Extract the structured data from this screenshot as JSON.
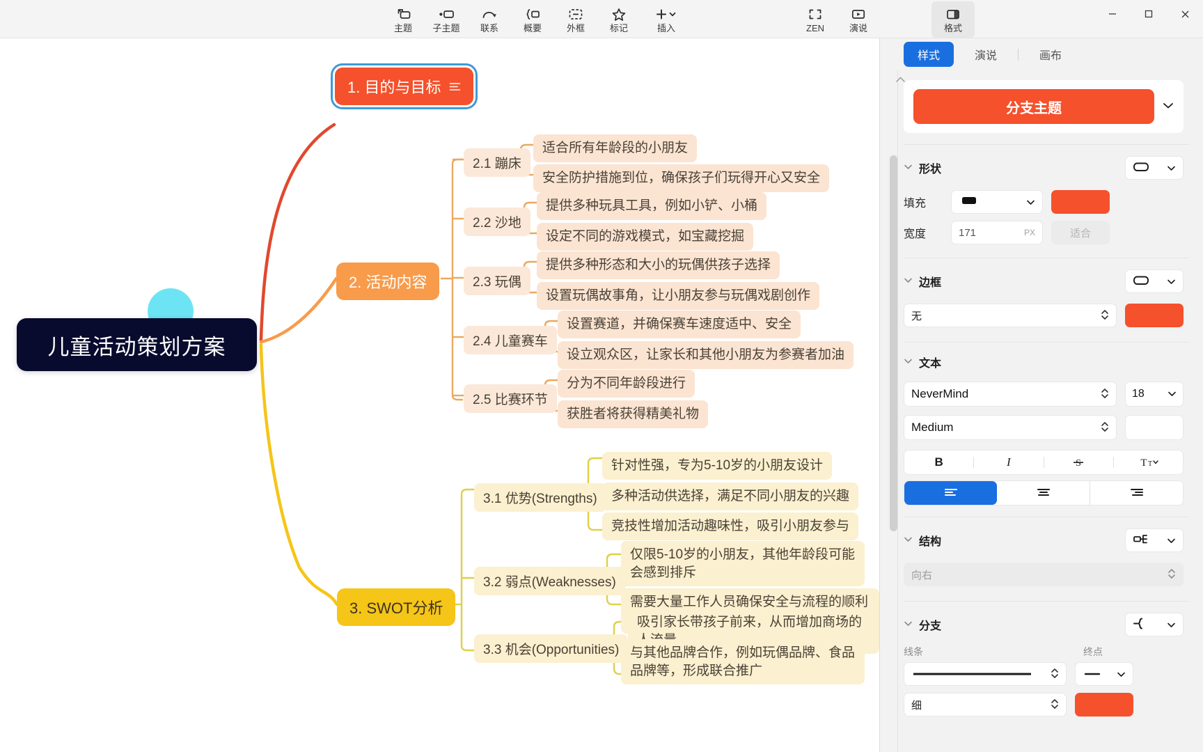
{
  "toolbar": {
    "items": [
      {
        "label": "主题",
        "icon": "topic-icon"
      },
      {
        "label": "子主题",
        "icon": "subtopic-icon"
      },
      {
        "label": "联系",
        "icon": "relationship-icon"
      },
      {
        "label": "概要",
        "icon": "summary-icon"
      },
      {
        "label": "外框",
        "icon": "boundary-icon"
      },
      {
        "label": "标记",
        "icon": "marker-star-icon"
      },
      {
        "label": "插入",
        "icon": "insert-plus-icon"
      }
    ],
    "right_items": [
      {
        "label": "ZEN",
        "icon": "zen-mode-icon"
      },
      {
        "label": "演说",
        "icon": "presentation-icon"
      }
    ],
    "format_item": {
      "label": "格式",
      "icon": "format-panel-icon"
    }
  },
  "window_controls": {
    "minimize": "minimize-icon",
    "maximize": "maximize-icon",
    "close": "close-icon"
  },
  "panel": {
    "tabs": [
      {
        "label": "样式",
        "active": true
      },
      {
        "label": "演说",
        "active": false
      },
      {
        "label": "画布",
        "active": false
      }
    ],
    "theme": {
      "label": "分支主题",
      "color": "#f4512c"
    },
    "shape": {
      "title": "形状",
      "shape_preview": "rounded-rect-icon",
      "fill_label": "填充",
      "fill_preview": "solid-black-rect",
      "fill_color": "#f4512c",
      "width_label": "宽度",
      "width_value": "171",
      "width_unit": "PX",
      "fit_label": "适合"
    },
    "border": {
      "title": "边框",
      "shape_preview": "rounded-rect-icon",
      "style_value": "无",
      "color": "#f4512c"
    },
    "text": {
      "title": "文本",
      "font_family": "NeverMind",
      "font_size": "18",
      "font_weight": "Medium",
      "bold": "B",
      "italic": "I",
      "strikethrough": "S",
      "text_case": "Tᴛ",
      "align_left": "align-left-icon",
      "align_center": "align-center-icon",
      "align_right": "align-right-icon"
    },
    "structure": {
      "title": "结构",
      "preview": "logic-right-icon",
      "value": "向右"
    },
    "branch": {
      "title": "分支",
      "preview": "branch-curve-icon",
      "line_label": "线条",
      "end_label": "终点",
      "line_preview": "solid-line",
      "end_preview": "flat-end-line",
      "thickness_value": "细",
      "color": "#f4512c"
    }
  },
  "mindmap": {
    "root": {
      "text": "儿童活动策划方案",
      "color": "#080a2e",
      "accent": "#6de4f4"
    },
    "branches": [
      {
        "id": "b1",
        "text": "1. 目的与目标",
        "color": "#f4512c",
        "selected": true,
        "has_note": true,
        "children": []
      },
      {
        "id": "b2",
        "text": "2. 活动内容",
        "color": "#f89b4b",
        "selected": false,
        "has_note": false,
        "children": [
          {
            "text": "2.1 蹦床",
            "children": [
              "适合所有年龄段的小朋友",
              "安全防护措施到位，确保孩子们玩得开心又安全"
            ]
          },
          {
            "text": "2.2 沙地",
            "children": [
              "提供多种玩具工具，例如小铲、小桶",
              "设定不同的游戏模式，如宝藏挖掘"
            ]
          },
          {
            "text": "2.3 玩偶",
            "children": [
              "提供多种形态和大小的玩偶供孩子选择",
              "设置玩偶故事角，让小朋友参与玩偶戏剧创作"
            ]
          },
          {
            "text": "2.4 儿童赛车",
            "children": [
              "设置赛道，并确保赛车速度适中、安全",
              "设立观众区，让家长和其他小朋友为参赛者加油"
            ]
          },
          {
            "text": "2.5 比赛环节",
            "children": [
              "分为不同年龄段进行",
              "获胜者将获得精美礼物"
            ]
          }
        ]
      },
      {
        "id": "b3",
        "text": "3. SWOT分析",
        "color": "#f5c518",
        "selected": false,
        "has_note": false,
        "children": [
          {
            "text": "3.1 优势(Strengths)",
            "children": [
              "针对性强，专为5-10岁的小朋友设计",
              "多种活动供选择，满足不同小朋友的兴趣",
              "竞技性增加活动趣味性，吸引小朋友参与"
            ]
          },
          {
            "text": "3.2 弱点(Weaknesses)",
            "children": [
              "仅限5-10岁的小朋友，其他年龄段可能会感到排斥",
              "需要大量工作人员确保安全与流程的顺利进行"
            ]
          },
          {
            "text": "3.3 机会(Opportunities)",
            "children": [
              "吸引家长带孩子前来，从而增加商场的人流量",
              "与其他品牌合作，例如玩偶品牌、食品品牌等，形成联合推广"
            ]
          }
        ]
      }
    ]
  }
}
